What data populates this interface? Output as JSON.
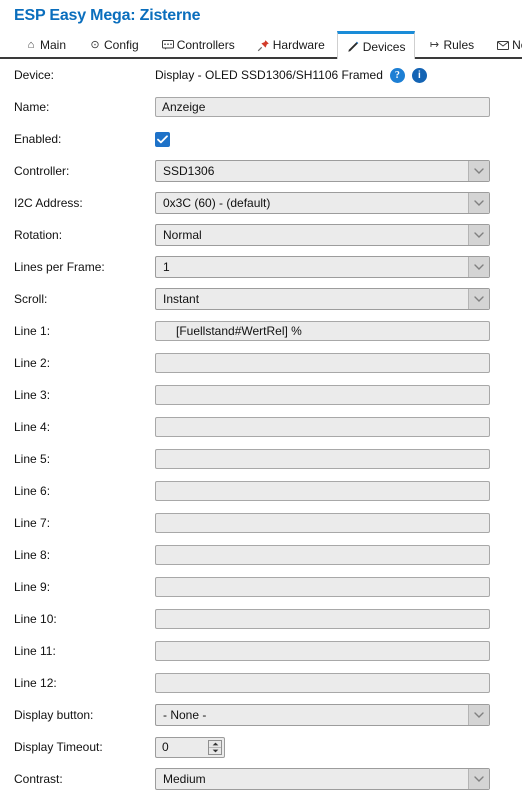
{
  "header": {
    "title": "ESP Easy Mega: Zisterne",
    "title_color": "#0a6ebd"
  },
  "tabs": [
    {
      "label": "Main",
      "icon": "home-icon",
      "glyph": "⌂",
      "active": false
    },
    {
      "label": "Config",
      "icon": "gear-icon",
      "glyph": "⊙",
      "active": false
    },
    {
      "label": "Controllers",
      "icon": "chat-bubble-icon",
      "glyph": "▭",
      "active": false
    },
    {
      "label": "Hardware",
      "icon": "pushpin-icon",
      "glyph": "📌",
      "active": false
    },
    {
      "label": "Devices",
      "icon": "plug-icon",
      "glyph": "🔌",
      "active": true
    },
    {
      "label": "Rules",
      "icon": "arrow-right-icon",
      "glyph": "↦",
      "active": false
    },
    {
      "label": "Notifications",
      "icon": "envelope-icon",
      "glyph": "✉",
      "active": false
    }
  ],
  "form": {
    "device": {
      "label": "Device:",
      "value": "Display - OLED SSD1306/SH1106 Framed",
      "help_badge": "?",
      "info_badge": "i",
      "badge_color": "#1d7fd4"
    },
    "name": {
      "label": "Name:",
      "value": "Anzeige"
    },
    "enabled": {
      "label": "Enabled:",
      "checked": true,
      "checkbox_color": "#1e72c8"
    },
    "controller": {
      "label": "Controller:",
      "value": "SSD1306"
    },
    "i2c_address": {
      "label": "I2C Address:",
      "value": "0x3C (60) - (default)"
    },
    "rotation": {
      "label": "Rotation:",
      "value": "Normal"
    },
    "lines_per_frame": {
      "label": "Lines per Frame:",
      "value": "1"
    },
    "scroll": {
      "label": "Scroll:",
      "value": "Instant"
    },
    "lines": [
      {
        "label": "Line 1:",
        "value": "[Fuellstand#WertRel] %"
      },
      {
        "label": "Line 2:",
        "value": ""
      },
      {
        "label": "Line 3:",
        "value": ""
      },
      {
        "label": "Line 4:",
        "value": ""
      },
      {
        "label": "Line 5:",
        "value": ""
      },
      {
        "label": "Line 6:",
        "value": ""
      },
      {
        "label": "Line 7:",
        "value": ""
      },
      {
        "label": "Line 8:",
        "value": ""
      },
      {
        "label": "Line 9:",
        "value": ""
      },
      {
        "label": "Line 10:",
        "value": ""
      },
      {
        "label": "Line 11:",
        "value": ""
      },
      {
        "label": "Line 12:",
        "value": ""
      }
    ],
    "display_button": {
      "label": "Display button:",
      "value": "- None -"
    },
    "display_timeout": {
      "label": "Display Timeout:",
      "value": "0"
    },
    "contrast": {
      "label": "Contrast:",
      "value": "Medium"
    }
  }
}
